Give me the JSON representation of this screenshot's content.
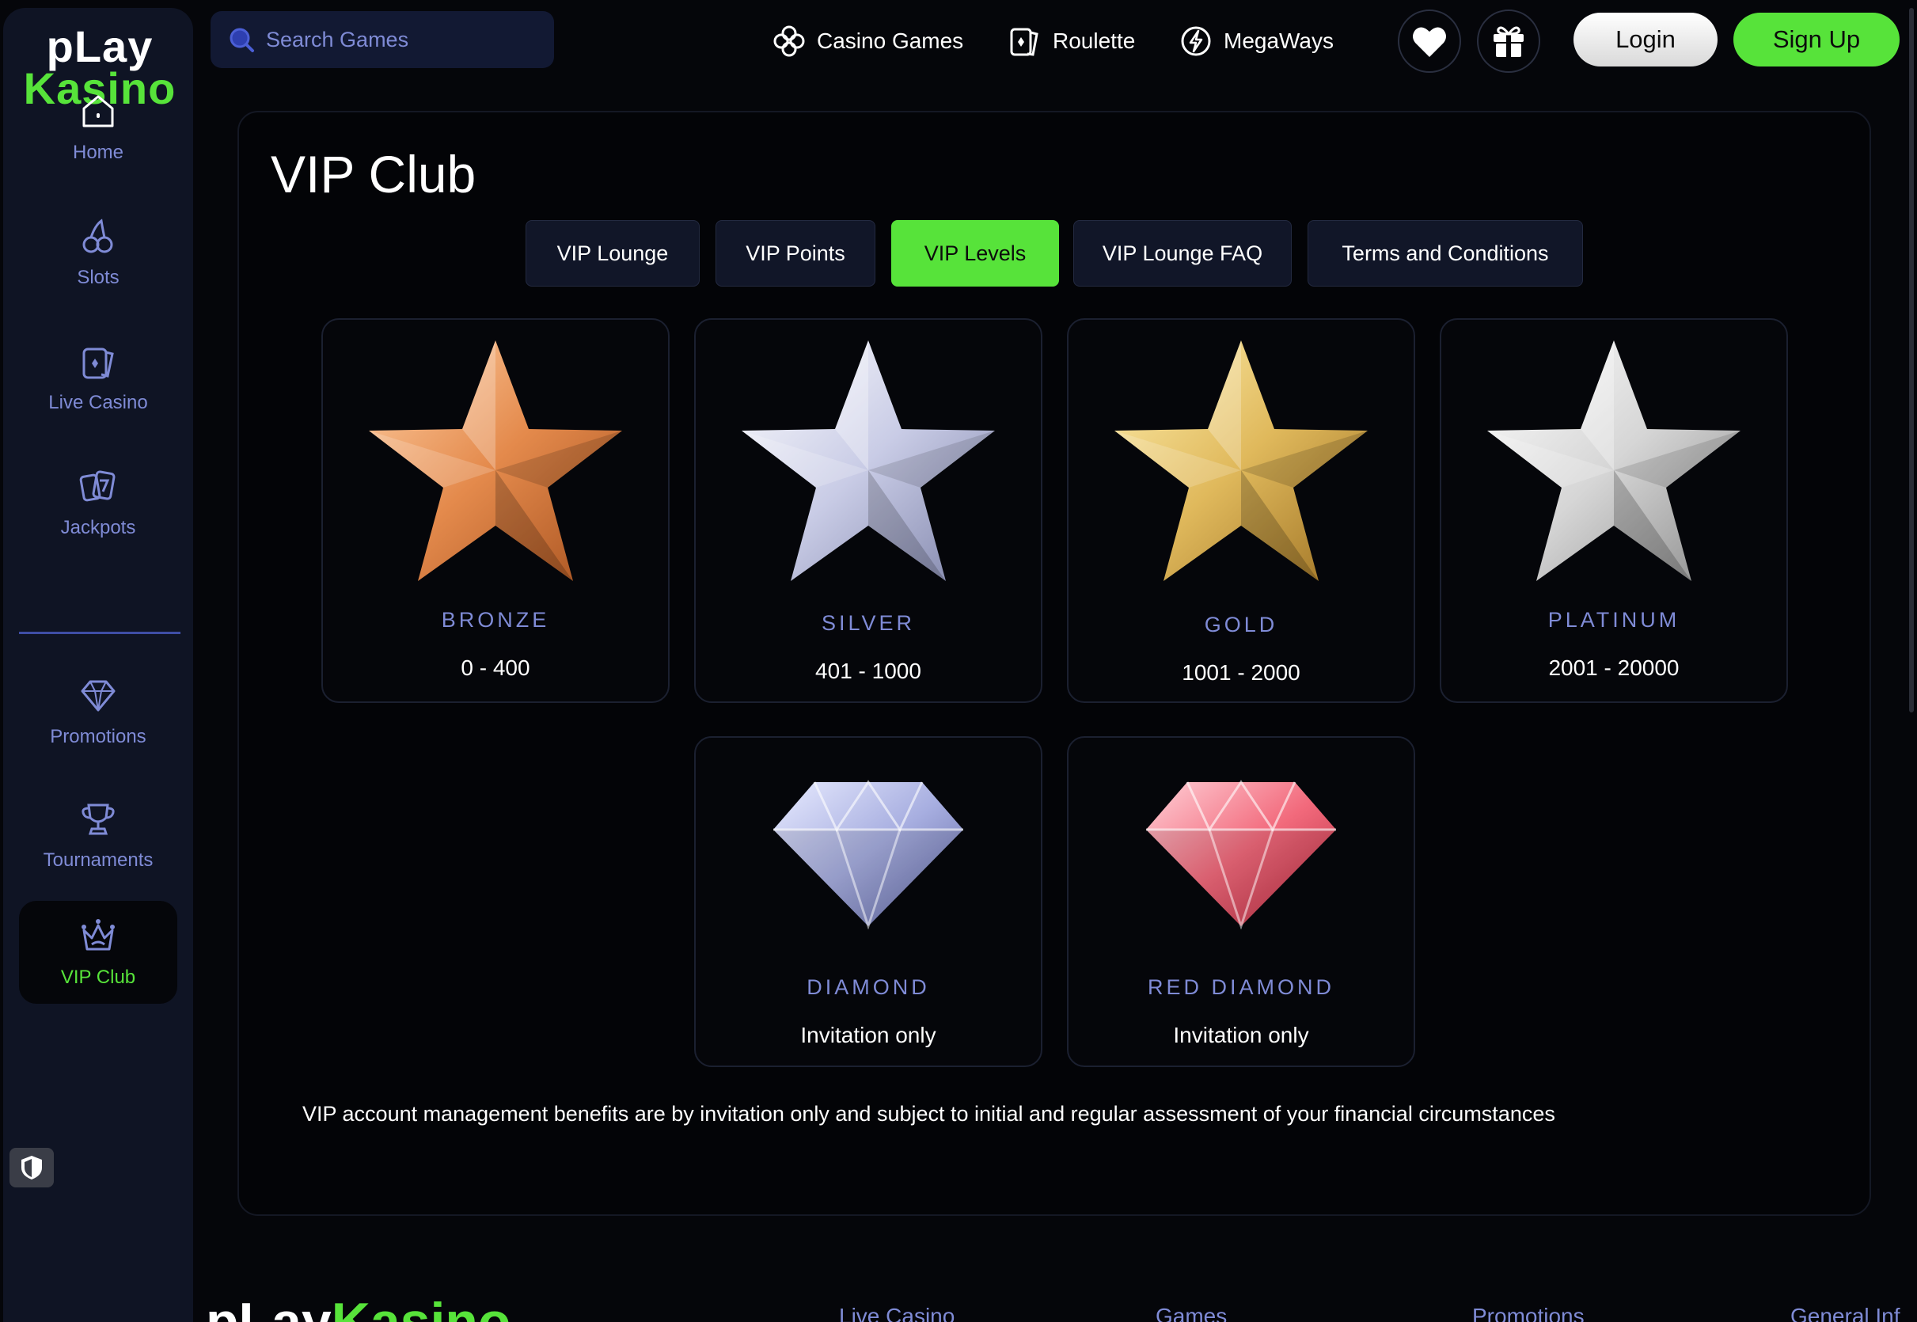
{
  "logo": {
    "line1": "pLay",
    "line2": "Kasino"
  },
  "search": {
    "placeholder": "Search Games"
  },
  "header": {
    "links": [
      {
        "label": "Casino Games",
        "icon": "clover-icon"
      },
      {
        "label": "Roulette",
        "icon": "card-icon"
      },
      {
        "label": "MegaWays",
        "icon": "bolt-icon"
      }
    ],
    "favorites_icon": "heart-icon",
    "gift_icon": "gift-icon",
    "login_label": "Login",
    "signup_label": "Sign Up"
  },
  "sidebar": {
    "items": [
      {
        "label": "Home",
        "icon": "home-icon"
      },
      {
        "label": "Slots",
        "icon": "cherry-icon"
      },
      {
        "label": "Live Casino",
        "icon": "card-icon"
      },
      {
        "label": "Jackpots",
        "icon": "cards-icon"
      },
      {
        "label": "Promotions",
        "icon": "gem-icon"
      },
      {
        "label": "Tournaments",
        "icon": "trophy-icon"
      },
      {
        "label": "VIP Club",
        "icon": "crown-icon",
        "active": true
      }
    ]
  },
  "page": {
    "title": "VIP Club",
    "tabs": [
      {
        "label": "VIP Lounge"
      },
      {
        "label": "VIP Points"
      },
      {
        "label": "VIP Levels",
        "active": true
      },
      {
        "label": "VIP Lounge FAQ"
      },
      {
        "label": "Terms and Conditions"
      }
    ],
    "levels": [
      {
        "name": "BRONZE",
        "range": "0 - 400",
        "badge": "bronze-star-icon"
      },
      {
        "name": "SILVER",
        "range": "401 - 1000",
        "badge": "silver-star-icon"
      },
      {
        "name": "GOLD",
        "range": "1001 - 2000",
        "badge": "gold-star-icon"
      },
      {
        "name": "PLATINUM",
        "range": "2001 - 20000",
        "badge": "platinum-star-icon"
      },
      {
        "name": "DIAMOND",
        "range": "Invitation only",
        "badge": "diamond-icon"
      },
      {
        "name": "RED DIAMOND",
        "range": "Invitation only",
        "badge": "red-diamond-icon"
      }
    ],
    "disclaimer": "VIP account management benefits are by invitation only and subject to initial and regular assessment of your financial circumstances"
  },
  "footer": {
    "logo_white": "pLay",
    "logo_green": "Kasino",
    "links": [
      "Live Casino",
      "Games",
      "Promotions",
      "General Inf"
    ]
  },
  "colors": {
    "accent": "#57e33a",
    "muted_text": "#7f8bd6",
    "background": "#05060a",
    "sidebar": "#0f1424"
  }
}
